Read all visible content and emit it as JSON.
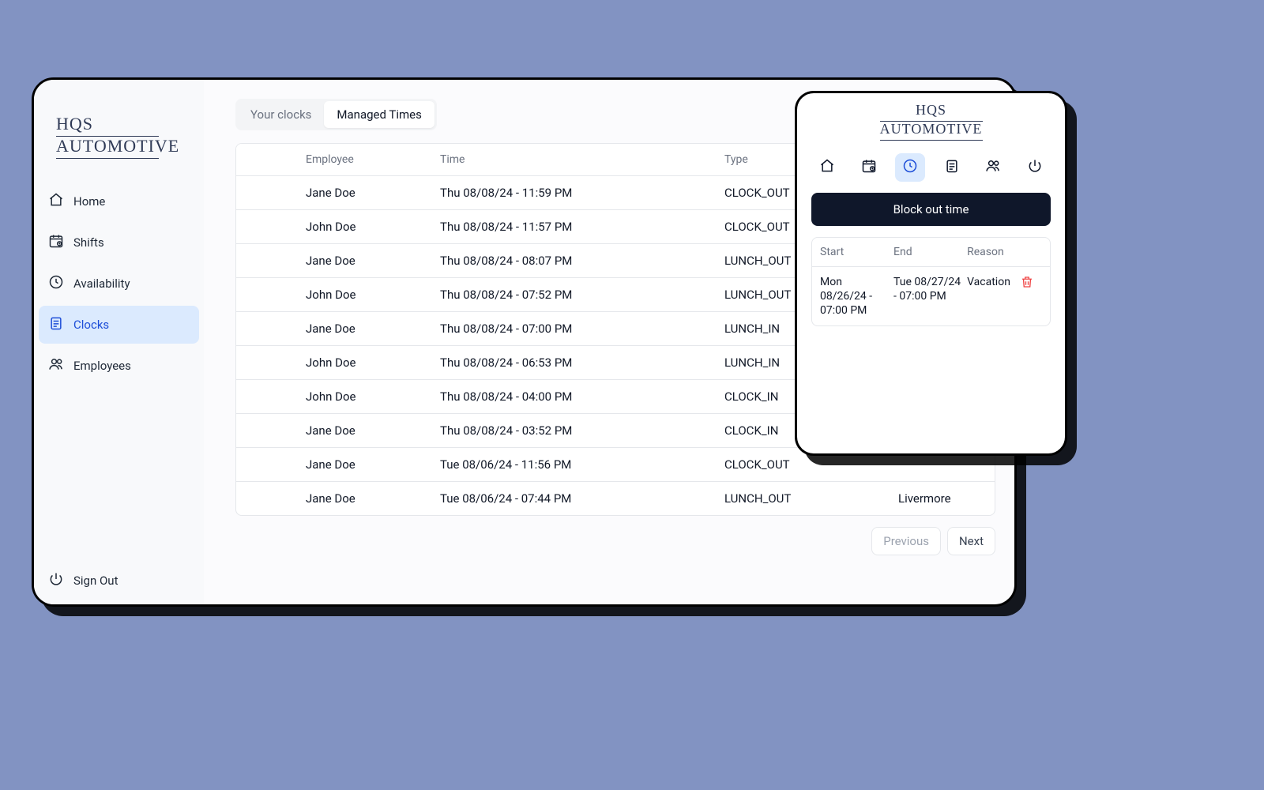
{
  "logo": {
    "line1": "HQS",
    "line2": "AUTOMOTIVE"
  },
  "sidebar": {
    "items": [
      {
        "label": "Home"
      },
      {
        "label": "Shifts"
      },
      {
        "label": "Availability"
      },
      {
        "label": "Clocks"
      },
      {
        "label": "Employees"
      }
    ],
    "signout": "Sign Out"
  },
  "tabs": {
    "your_clocks": "Your clocks",
    "managed_times": "Managed Times"
  },
  "table": {
    "headers": {
      "employee": "Employee",
      "time": "Time",
      "type": "Type"
    },
    "rows": [
      {
        "employee": "Jane Doe",
        "time": "Thu 08/08/24 - 11:59 PM",
        "type": "CLOCK_OUT",
        "location": ""
      },
      {
        "employee": "John Doe",
        "time": "Thu 08/08/24 - 11:57 PM",
        "type": "CLOCK_OUT",
        "location": ""
      },
      {
        "employee": "Jane Doe",
        "time": "Thu 08/08/24 - 08:07 PM",
        "type": "LUNCH_OUT",
        "location": ""
      },
      {
        "employee": "John Doe",
        "time": "Thu 08/08/24 - 07:52 PM",
        "type": "LUNCH_OUT",
        "location": ""
      },
      {
        "employee": "Jane Doe",
        "time": "Thu 08/08/24 - 07:00 PM",
        "type": "LUNCH_IN",
        "location": ""
      },
      {
        "employee": "John Doe",
        "time": "Thu 08/08/24 - 06:53 PM",
        "type": "LUNCH_IN",
        "location": ""
      },
      {
        "employee": "John Doe",
        "time": "Thu 08/08/24 - 04:00 PM",
        "type": "CLOCK_IN",
        "location": ""
      },
      {
        "employee": "Jane Doe",
        "time": "Thu 08/08/24 - 03:52 PM",
        "type": "CLOCK_IN",
        "location": ""
      },
      {
        "employee": "Jane Doe",
        "time": "Tue 08/06/24 - 11:56 PM",
        "type": "CLOCK_OUT",
        "location": ""
      },
      {
        "employee": "Jane Doe",
        "time": "Tue 08/06/24 - 07:44 PM",
        "type": "LUNCH_OUT",
        "location": "Livermore"
      }
    ]
  },
  "pagination": {
    "prev": "Previous",
    "next": "Next"
  },
  "mobile": {
    "block_btn": "Block out time",
    "headers": {
      "start": "Start",
      "end": "End",
      "reason": "Reason"
    },
    "row": {
      "start": "Mon 08/26/24 - 07:00 PM",
      "end": "Tue 08/27/24 - 07:00 PM",
      "reason": "Vacation"
    }
  }
}
